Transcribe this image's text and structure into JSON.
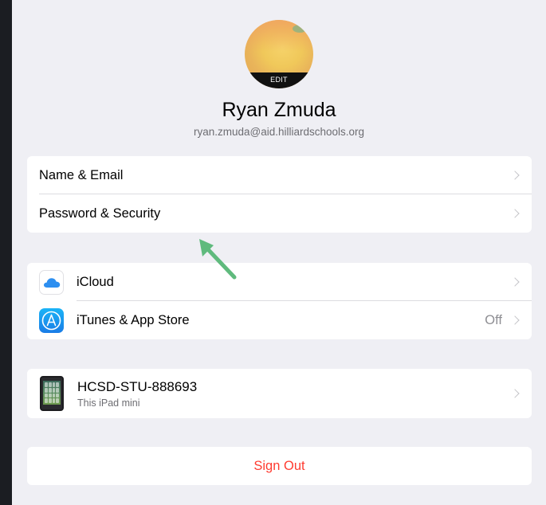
{
  "profile": {
    "avatar_edit_label": "EDIT",
    "name": "Ryan Zmuda",
    "email": "ryan.zmuda@aid.hilliardschools.org"
  },
  "account_group": {
    "items": [
      {
        "label": "Name & Email"
      },
      {
        "label": "Password & Security"
      }
    ]
  },
  "services_group": {
    "items": [
      {
        "label": "iCloud",
        "icon": "icloud-icon"
      },
      {
        "label": "iTunes & App Store",
        "icon": "app-store-icon",
        "value": "Off"
      }
    ]
  },
  "device": {
    "name": "HCSD-STU-888693",
    "subtitle": "This iPad mini",
    "icon": "ipad-icon"
  },
  "sign_out_label": "Sign Out",
  "annotation": {
    "icon": "green-arrow-icon",
    "color": "#5fba7d"
  },
  "colors": {
    "background": "#efeff4",
    "destructive": "#ff3b30",
    "secondary_text": "#6d6d72"
  }
}
